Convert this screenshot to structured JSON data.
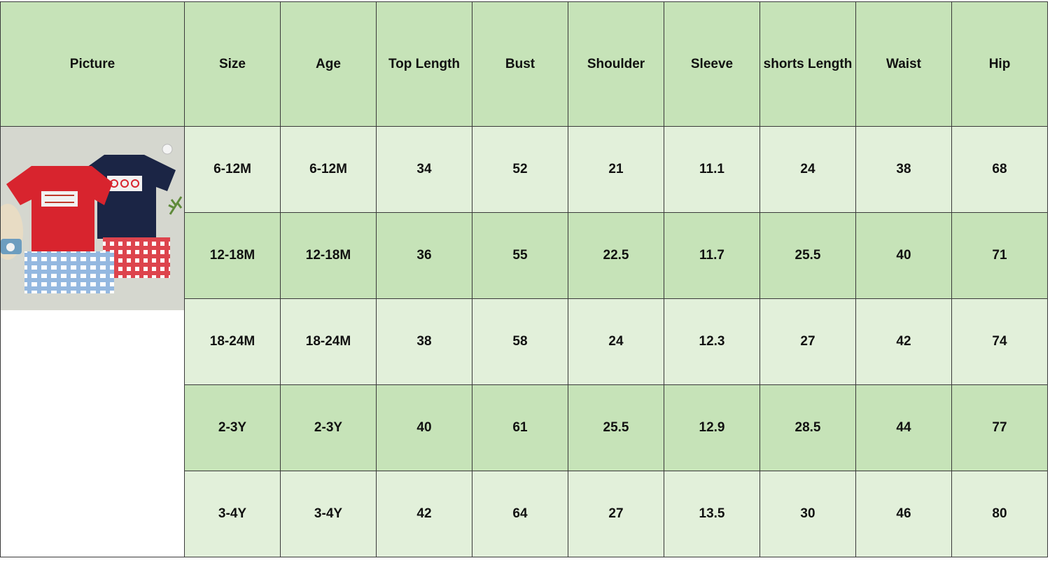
{
  "table": {
    "headers": [
      "Picture",
      "Size",
      "Age",
      "Top Length",
      "Bust",
      "Shoulder",
      "Sleeve",
      "shorts Length",
      "Waist",
      "Hip"
    ],
    "rows": [
      [
        "6-12M",
        "6-12M",
        "34",
        "52",
        "21",
        "11.1",
        "24",
        "38",
        "68"
      ],
      [
        "12-18M",
        "12-18M",
        "36",
        "55",
        "22.5",
        "11.7",
        "25.5",
        "40",
        "71"
      ],
      [
        "18-24M",
        "18-24M",
        "38",
        "58",
        "24",
        "12.3",
        "27",
        "42",
        "74"
      ],
      [
        "2-3Y",
        "2-3Y",
        "40",
        "61",
        "25.5",
        "12.9",
        "28.5",
        "44",
        "77"
      ],
      [
        "3-4Y",
        "3-4Y",
        "42",
        "64",
        "27",
        "13.5",
        "30",
        "46",
        "80"
      ]
    ]
  },
  "colors": {
    "header_green": "#c6e3b8",
    "light_green": "#e2f0da",
    "shirt_red": "#d8242e",
    "shirt_navy": "#1b2545"
  }
}
